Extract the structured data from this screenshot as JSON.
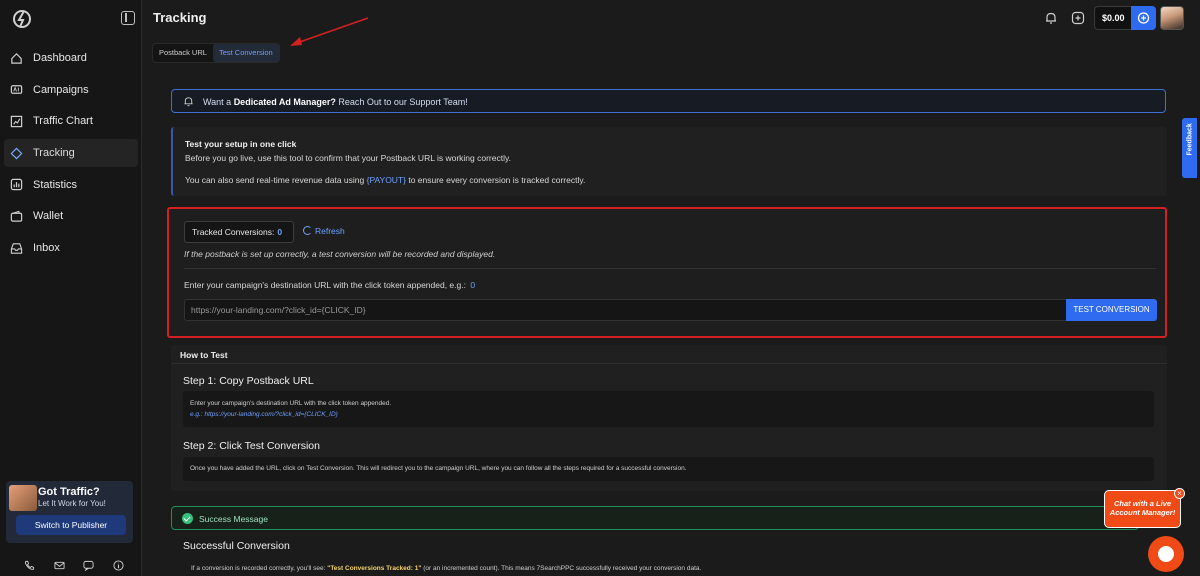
{
  "header": {
    "title": "Tracking",
    "balance": "$0.00"
  },
  "sidebar": {
    "items": [
      {
        "label": "Dashboard",
        "icon": "home-icon",
        "active": false
      },
      {
        "label": "Campaigns",
        "icon": "ad-icon",
        "active": false
      },
      {
        "label": "Traffic Chart",
        "icon": "chart-icon",
        "active": false
      },
      {
        "label": "Tracking",
        "icon": "diamond-icon",
        "active": true
      },
      {
        "label": "Statistics",
        "icon": "stats-icon",
        "active": false
      },
      {
        "label": "Wallet",
        "icon": "wallet-icon",
        "active": false
      },
      {
        "label": "Inbox",
        "icon": "inbox-icon",
        "active": false
      }
    ],
    "promo": {
      "title": "Got Traffic?",
      "subtitle": "Let It Work for You!",
      "button": "Switch to Publisher"
    }
  },
  "tabs": [
    {
      "label": "Postback URL",
      "active": false
    },
    {
      "label": "Test Conversion",
      "active": true
    }
  ],
  "notice": {
    "prefix": "Want a ",
    "bold": "Dedicated Ad Manager?",
    "suffix": " Reach Out to our Support Team!"
  },
  "intro": {
    "title": "Test your setup in one click",
    "line1": "Before you go live, use this tool to confirm that your Postback URL is working correctly.",
    "line2_prefix": "You can also send real-time revenue data using ",
    "line2_token": "{PAYOUT}",
    "line2_suffix": " to ensure every conversion is tracked correctly."
  },
  "test": {
    "tracked_label": "Tracked Conversions:",
    "tracked_count": "0",
    "refresh": "Refresh",
    "hint": "If the postback is set up correctly, a test conversion will be recorded and displayed.",
    "url_label": "Enter your campaign's destination URL with the click token appended, e.g.:",
    "url_label_value": "0",
    "url_placeholder": "https://your-landing.com/?click_id={CLICK_ID}",
    "button": "TEST CONVERSION"
  },
  "howto": {
    "title": "How to Test",
    "step1_title": "Step 1: Copy Postback URL",
    "step1_line1": "Enter your campaign's destination URL with the click token appended.",
    "step1_line2": "e.g.: https://your-landing.com/?click_id={CLICK_ID}",
    "step2_title": "Step 2: Click Test Conversion",
    "step2_line1": "Once you have added the URL, click on Test Conversion. This will redirect you to the campaign URL, where you can follow all the steps required for a successful conversion."
  },
  "success": {
    "label": "Success Message",
    "title": "Successful Conversion",
    "p_prefix": "If a conversion is recorded correctly, you'll see: ",
    "p_highlight": "\"Test Conversions Tracked: 1\"",
    "p_suffix": " (or an incremented count). This means 7SearchPPC successfully received your conversion data."
  },
  "feedback": "Feedback",
  "chat": {
    "bubble": "Chat with a Live Account Manager!",
    "close": "×"
  },
  "colors": {
    "accent": "#2f6bf0",
    "link": "#6fa0ff",
    "highlight_border": "#d42020",
    "success": "#36c07a",
    "chat": "#f04a16"
  }
}
